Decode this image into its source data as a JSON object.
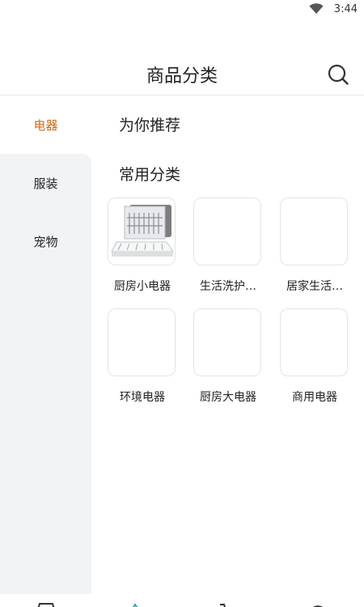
{
  "status": {
    "time": "3:44",
    "wifi_icon": "wifi-icon"
  },
  "header": {
    "title": "商品分类",
    "search_icon": "search-icon"
  },
  "sidebar": {
    "items": [
      {
        "label": "电器",
        "active": true
      },
      {
        "label": "服装",
        "active": false
      },
      {
        "label": "宠物",
        "active": false
      }
    ]
  },
  "main": {
    "recommend_title": "为你推荐",
    "common_title": "常用分类",
    "categories": [
      {
        "label": "厨房小电器",
        "has_image": true
      },
      {
        "label": "生活洗护…",
        "has_image": false
      },
      {
        "label": "居家生活…",
        "has_image": false
      },
      {
        "label": "环境电器",
        "has_image": false
      },
      {
        "label": "厨房大电器",
        "has_image": false
      },
      {
        "label": "商用电器",
        "has_image": false
      }
    ]
  },
  "colors": {
    "accent": "#d2691e",
    "sidebar_bg": "#f2f3f5"
  },
  "tabbar": {
    "icons": [
      "home-icon",
      "category-icon",
      "cart-icon",
      "profile-icon"
    ]
  }
}
